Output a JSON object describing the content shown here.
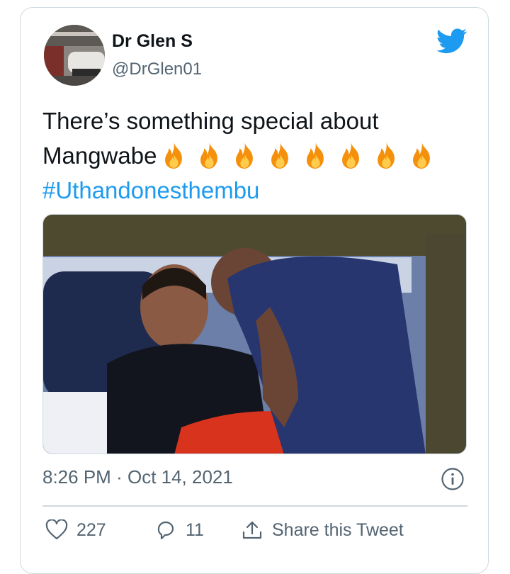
{
  "tweet": {
    "author_name": "Dr Glen S",
    "author_handle": "@DrGlen01",
    "text_line1": "There’s something special about",
    "text_line2": "Mangwabe",
    "emoji_icon": "fire-icon",
    "emoji_count": 8,
    "hashtag": "#Uthandonesthembu",
    "time": "8:26 PM",
    "separator": "·",
    "date": "Oct 14, 2021"
  },
  "actions": {
    "likes_count": "227",
    "replies_count": "11",
    "share_label": "Share this Tweet"
  },
  "icons": {
    "brand": "twitter-bird-icon",
    "info": "info-icon",
    "like": "heart-icon",
    "reply": "reply-icon",
    "share": "share-icon"
  },
  "colors": {
    "accent": "#1d9bf0",
    "text_primary": "#0f1419",
    "text_secondary": "#536471",
    "border": "#cfd9de"
  }
}
